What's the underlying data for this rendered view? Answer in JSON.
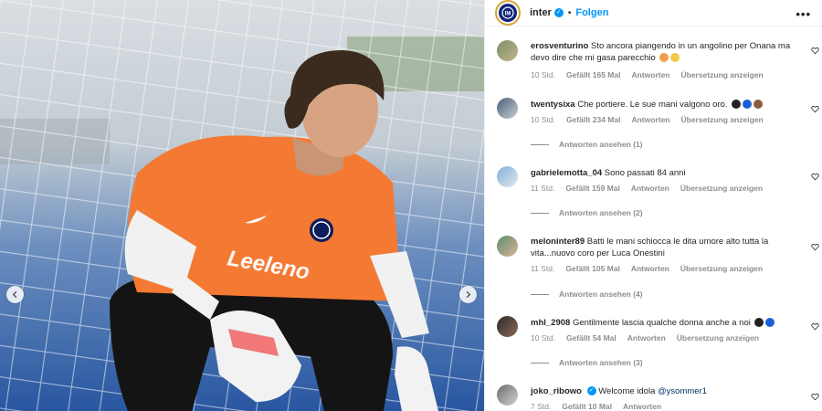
{
  "post": {
    "account": "inter",
    "follow_label": "Folgen",
    "more_label": "•••"
  },
  "media": {
    "jersey_sponsor": "Leeleno"
  },
  "comments": [
    {
      "user": "erosventurino",
      "text": "Sto ancora piangendo in un angolino per Onana ma devo dire che mi gasa parecchio",
      "time": "10 Std.",
      "likes": "Gefällt 165 Mal",
      "reply": "Antworten",
      "translate": "Übersetzung anzeigen",
      "replies": "",
      "emojis": [
        "#f0a04b",
        "#f2c94c"
      ]
    },
    {
      "user": "twentysixa",
      "text": "Che portiere. Le sue mani valgono oro.",
      "time": "10 Std.",
      "likes": "Gefällt 234 Mal",
      "reply": "Antworten",
      "translate": "Übersetzung anzeigen",
      "replies": "Antworten ansehen (1)",
      "emojis": [
        "#222222",
        "#1a5fd6",
        "#8d5a3b"
      ]
    },
    {
      "user": "gabrielemotta_04",
      "text": "Sono passati 84 anni",
      "time": "11 Std.",
      "likes": "Gefällt 159 Mal",
      "reply": "Antworten",
      "translate": "Übersetzung anzeigen",
      "replies": "Antworten ansehen (2)",
      "emojis": []
    },
    {
      "user": "meloninter89",
      "text": "Batti le mani schiocca le dita umore alto tutta la vita...nuovo coro per Luca Onestini",
      "time": "11 Std.",
      "likes": "Gefällt 105 Mal",
      "reply": "Antworten",
      "translate": "Übersetzung anzeigen",
      "replies": "Antworten ansehen (4)",
      "emojis": []
    },
    {
      "user": "mhl_2908",
      "text": "Gentilmente lascia qualche donna anche a noi",
      "time": "10 Std.",
      "likes": "Gefällt 54 Mal",
      "reply": "Antworten",
      "translate": "Übersetzung anzeigen",
      "replies": "Antworten ansehen (3)",
      "emojis": [
        "#222222",
        "#1a5fd6"
      ]
    },
    {
      "user": "joko_ribowo",
      "text": "Welcome idola",
      "mention": "@ysommer1",
      "time": "7 Std.",
      "likes": "Gefällt 10 Mal",
      "reply": "Antworten",
      "translate": "",
      "replies": "",
      "emojis": []
    }
  ],
  "colors": {
    "link": "#0095f6",
    "muted": "#8e8e8e",
    "jersey": "#f47a33"
  }
}
